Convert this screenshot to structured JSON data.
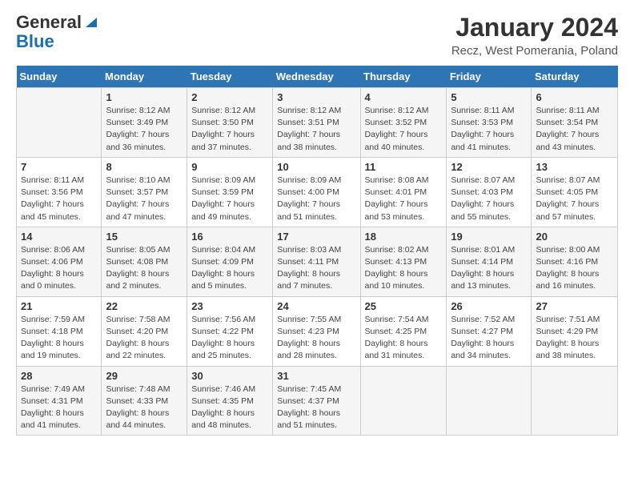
{
  "header": {
    "logo_general": "General",
    "logo_blue": "Blue",
    "month": "January 2024",
    "location": "Recz, West Pomerania, Poland"
  },
  "days_of_week": [
    "Sunday",
    "Monday",
    "Tuesday",
    "Wednesday",
    "Thursday",
    "Friday",
    "Saturday"
  ],
  "weeks": [
    [
      {
        "day": "",
        "info": ""
      },
      {
        "day": "1",
        "info": "Sunrise: 8:12 AM\nSunset: 3:49 PM\nDaylight: 7 hours\nand 36 minutes."
      },
      {
        "day": "2",
        "info": "Sunrise: 8:12 AM\nSunset: 3:50 PM\nDaylight: 7 hours\nand 37 minutes."
      },
      {
        "day": "3",
        "info": "Sunrise: 8:12 AM\nSunset: 3:51 PM\nDaylight: 7 hours\nand 38 minutes."
      },
      {
        "day": "4",
        "info": "Sunrise: 8:12 AM\nSunset: 3:52 PM\nDaylight: 7 hours\nand 40 minutes."
      },
      {
        "day": "5",
        "info": "Sunrise: 8:11 AM\nSunset: 3:53 PM\nDaylight: 7 hours\nand 41 minutes."
      },
      {
        "day": "6",
        "info": "Sunrise: 8:11 AM\nSunset: 3:54 PM\nDaylight: 7 hours\nand 43 minutes."
      }
    ],
    [
      {
        "day": "7",
        "info": "Sunrise: 8:11 AM\nSunset: 3:56 PM\nDaylight: 7 hours\nand 45 minutes."
      },
      {
        "day": "8",
        "info": "Sunrise: 8:10 AM\nSunset: 3:57 PM\nDaylight: 7 hours\nand 47 minutes."
      },
      {
        "day": "9",
        "info": "Sunrise: 8:09 AM\nSunset: 3:59 PM\nDaylight: 7 hours\nand 49 minutes."
      },
      {
        "day": "10",
        "info": "Sunrise: 8:09 AM\nSunset: 4:00 PM\nDaylight: 7 hours\nand 51 minutes."
      },
      {
        "day": "11",
        "info": "Sunrise: 8:08 AM\nSunset: 4:01 PM\nDaylight: 7 hours\nand 53 minutes."
      },
      {
        "day": "12",
        "info": "Sunrise: 8:07 AM\nSunset: 4:03 PM\nDaylight: 7 hours\nand 55 minutes."
      },
      {
        "day": "13",
        "info": "Sunrise: 8:07 AM\nSunset: 4:05 PM\nDaylight: 7 hours\nand 57 minutes."
      }
    ],
    [
      {
        "day": "14",
        "info": "Sunrise: 8:06 AM\nSunset: 4:06 PM\nDaylight: 8 hours\nand 0 minutes."
      },
      {
        "day": "15",
        "info": "Sunrise: 8:05 AM\nSunset: 4:08 PM\nDaylight: 8 hours\nand 2 minutes."
      },
      {
        "day": "16",
        "info": "Sunrise: 8:04 AM\nSunset: 4:09 PM\nDaylight: 8 hours\nand 5 minutes."
      },
      {
        "day": "17",
        "info": "Sunrise: 8:03 AM\nSunset: 4:11 PM\nDaylight: 8 hours\nand 7 minutes."
      },
      {
        "day": "18",
        "info": "Sunrise: 8:02 AM\nSunset: 4:13 PM\nDaylight: 8 hours\nand 10 minutes."
      },
      {
        "day": "19",
        "info": "Sunrise: 8:01 AM\nSunset: 4:14 PM\nDaylight: 8 hours\nand 13 minutes."
      },
      {
        "day": "20",
        "info": "Sunrise: 8:00 AM\nSunset: 4:16 PM\nDaylight: 8 hours\nand 16 minutes."
      }
    ],
    [
      {
        "day": "21",
        "info": "Sunrise: 7:59 AM\nSunset: 4:18 PM\nDaylight: 8 hours\nand 19 minutes."
      },
      {
        "day": "22",
        "info": "Sunrise: 7:58 AM\nSunset: 4:20 PM\nDaylight: 8 hours\nand 22 minutes."
      },
      {
        "day": "23",
        "info": "Sunrise: 7:56 AM\nSunset: 4:22 PM\nDaylight: 8 hours\nand 25 minutes."
      },
      {
        "day": "24",
        "info": "Sunrise: 7:55 AM\nSunset: 4:23 PM\nDaylight: 8 hours\nand 28 minutes."
      },
      {
        "day": "25",
        "info": "Sunrise: 7:54 AM\nSunset: 4:25 PM\nDaylight: 8 hours\nand 31 minutes."
      },
      {
        "day": "26",
        "info": "Sunrise: 7:52 AM\nSunset: 4:27 PM\nDaylight: 8 hours\nand 34 minutes."
      },
      {
        "day": "27",
        "info": "Sunrise: 7:51 AM\nSunset: 4:29 PM\nDaylight: 8 hours\nand 38 minutes."
      }
    ],
    [
      {
        "day": "28",
        "info": "Sunrise: 7:49 AM\nSunset: 4:31 PM\nDaylight: 8 hours\nand 41 minutes."
      },
      {
        "day": "29",
        "info": "Sunrise: 7:48 AM\nSunset: 4:33 PM\nDaylight: 8 hours\nand 44 minutes."
      },
      {
        "day": "30",
        "info": "Sunrise: 7:46 AM\nSunset: 4:35 PM\nDaylight: 8 hours\nand 48 minutes."
      },
      {
        "day": "31",
        "info": "Sunrise: 7:45 AM\nSunset: 4:37 PM\nDaylight: 8 hours\nand 51 minutes."
      },
      {
        "day": "",
        "info": ""
      },
      {
        "day": "",
        "info": ""
      },
      {
        "day": "",
        "info": ""
      }
    ]
  ]
}
